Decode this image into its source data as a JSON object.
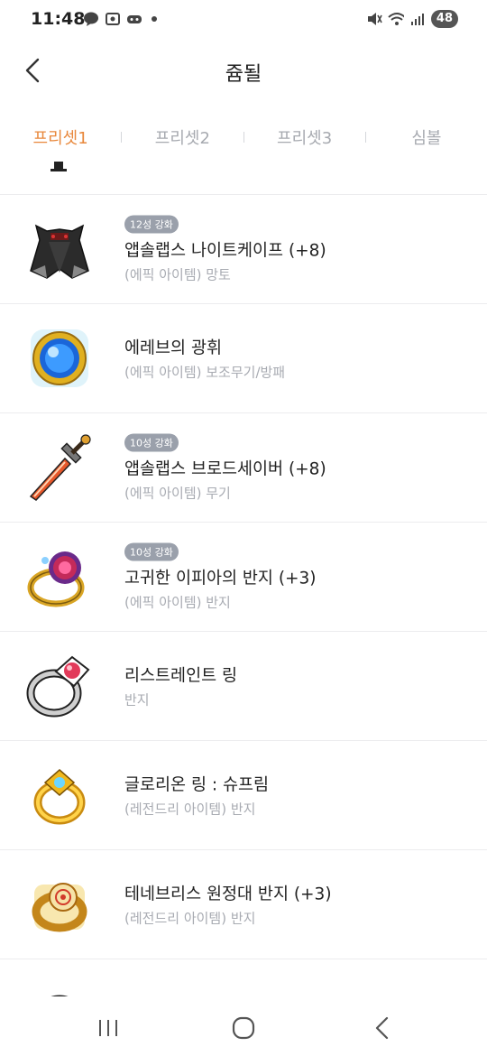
{
  "status": {
    "time": "11:48",
    "battery": "48"
  },
  "header": {
    "title": "쥼될"
  },
  "tabs": [
    {
      "label": "프리셋1",
      "active": true
    },
    {
      "label": "프리셋2",
      "active": false
    },
    {
      "label": "프리셋3",
      "active": false
    },
    {
      "label": "심볼",
      "active": false
    }
  ],
  "items": [
    {
      "badge": "12성 강화",
      "name": "앱솔랩스 나이트케이프 (+8)",
      "sub": "(에픽 아이템) 망토",
      "icon": "cape-icon"
    },
    {
      "badge": "",
      "name": "에레브의 광휘",
      "sub": "(에픽 아이템) 보조무기/방패",
      "icon": "orb-icon"
    },
    {
      "badge": "10성 강화",
      "name": "앱솔랩스 브로드세이버 (+8)",
      "sub": "(에픽 아이템) 무기",
      "icon": "sword-icon"
    },
    {
      "badge": "10성 강화",
      "name": "고귀한 이피아의 반지 (+3)",
      "sub": "(에픽 아이템) 반지",
      "icon": "rose-ring-icon"
    },
    {
      "badge": "",
      "name": "리스트레인트 링",
      "sub": "반지",
      "icon": "ring-icon"
    },
    {
      "badge": "",
      "name": "글로리온 링 : 슈프림",
      "sub": "(레전드리 아이템) 반지",
      "icon": "gold-ring-icon"
    },
    {
      "badge": "",
      "name": "테네브리스 원정대 반지 (+3)",
      "sub": "(레전드리 아이템) 반지",
      "icon": "expedition-ring-icon"
    }
  ]
}
